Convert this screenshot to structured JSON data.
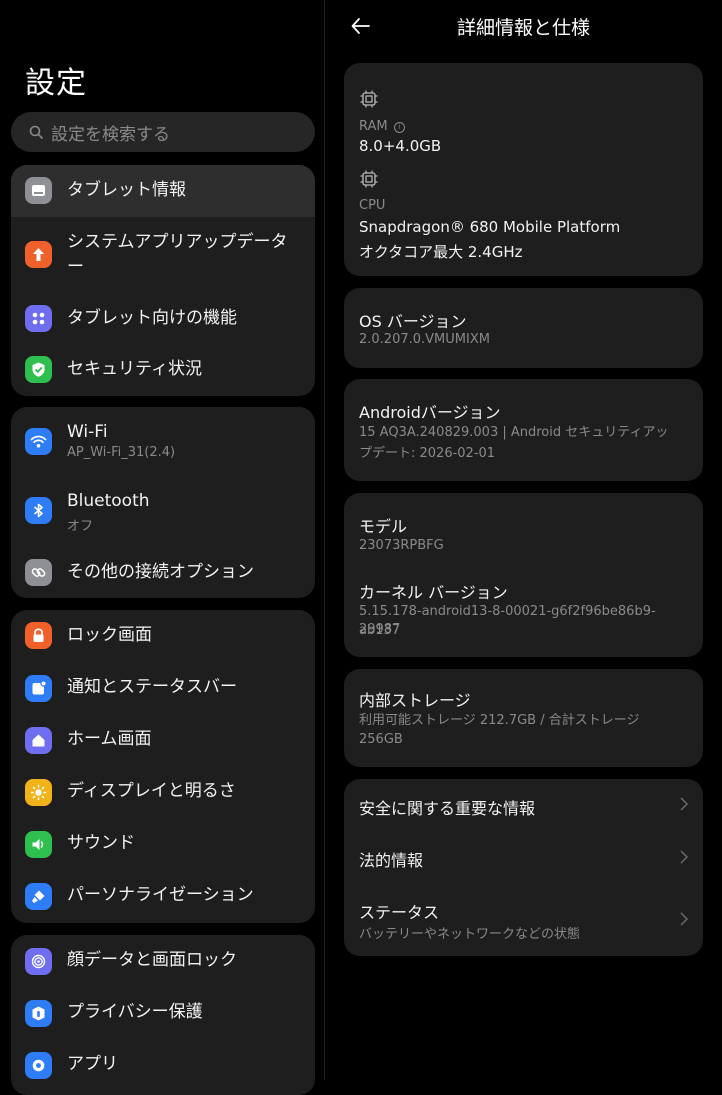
{
  "left": {
    "title": "設定",
    "search_placeholder": "設定を検索する",
    "group1": [
      {
        "label": "タブレット情報",
        "icon": "tablet-icon",
        "color": "#8e9095"
      },
      {
        "label": "システムアプリアップデーター",
        "icon": "upload-arrow-icon",
        "color": "#f0602a"
      },
      {
        "label": "タブレット向けの機能",
        "icon": "grid-dots-icon",
        "color": "#6f6ef0"
      },
      {
        "label": "セキュリティ状況",
        "icon": "shield-check-icon",
        "color": "#2fbf4f"
      }
    ],
    "group2": [
      {
        "label": "Wi-Fi",
        "sub": "AP_Wi-Fi_31(2.4)",
        "icon": "wifi-icon",
        "color": "#2e7cf6"
      },
      {
        "label": "Bluetooth",
        "sub": "オフ",
        "icon": "bluetooth-icon",
        "color": "#2e7cf6"
      },
      {
        "label": "その他の接続オプション",
        "icon": "link-icon",
        "color": "#8e9095"
      }
    ],
    "group3": [
      {
        "label": "ロック画面",
        "icon": "lock-icon",
        "color": "#f0602a"
      },
      {
        "label": "通知とステータスバー",
        "icon": "notification-icon",
        "color": "#2e7cf6"
      },
      {
        "label": "ホーム画面",
        "icon": "home-icon",
        "color": "#6f6ef0"
      },
      {
        "label": "ディスプレイと明るさ",
        "icon": "sun-icon",
        "color": "#f2b21a"
      },
      {
        "label": "サウンド",
        "icon": "speaker-icon",
        "color": "#2fbf4f"
      },
      {
        "label": "パーソナライゼーション",
        "icon": "brush-icon",
        "color": "#2e7cf6"
      }
    ],
    "group4": [
      {
        "label": "顔データと画面ロック",
        "icon": "fingerprint-icon",
        "color": "#6f6ef0"
      },
      {
        "label": "プライバシー保護",
        "icon": "privacy-icon",
        "color": "#2e7cf6"
      },
      {
        "label": "アプリ",
        "icon": "gear-icon",
        "color": "#2e7cf6"
      }
    ]
  },
  "right": {
    "title": "詳細情報と仕様",
    "ram_label": "RAM",
    "ram_value": "8.0+4.0GB",
    "cpu_label": "CPU",
    "cpu_value1": "Snapdragon® 680 Mobile Platform",
    "cpu_value2": "オクタコア最大 2.4GHz",
    "os_title": "OS バージョン",
    "os_value": "2.0.207.0.VMUMIXM",
    "android_title": "Androidバージョン",
    "android_value1": "15 AQ3A.240829.003 | Android セキュリティアッ",
    "android_value2": "プデート: 2026-02-01",
    "model_title": "モデル",
    "model_value": "23073RPBFG",
    "kernel_title": "カーネル バージョン",
    "kernel_value1": "5.15.178-android13-8-00021-g6f2f96be86b9-ab137",
    "kernel_value2": "29987",
    "storage_title": "内部ストレージ",
    "storage_value1": "利用可能ストレージ  212.7GB / 合計ストレージ",
    "storage_value2": "256GB",
    "safety_label": "安全に関する重要な情報",
    "legal_label": "法的情報",
    "status_label": "ステータス",
    "status_sub": "バッテリーやネットワークなどの状態"
  }
}
